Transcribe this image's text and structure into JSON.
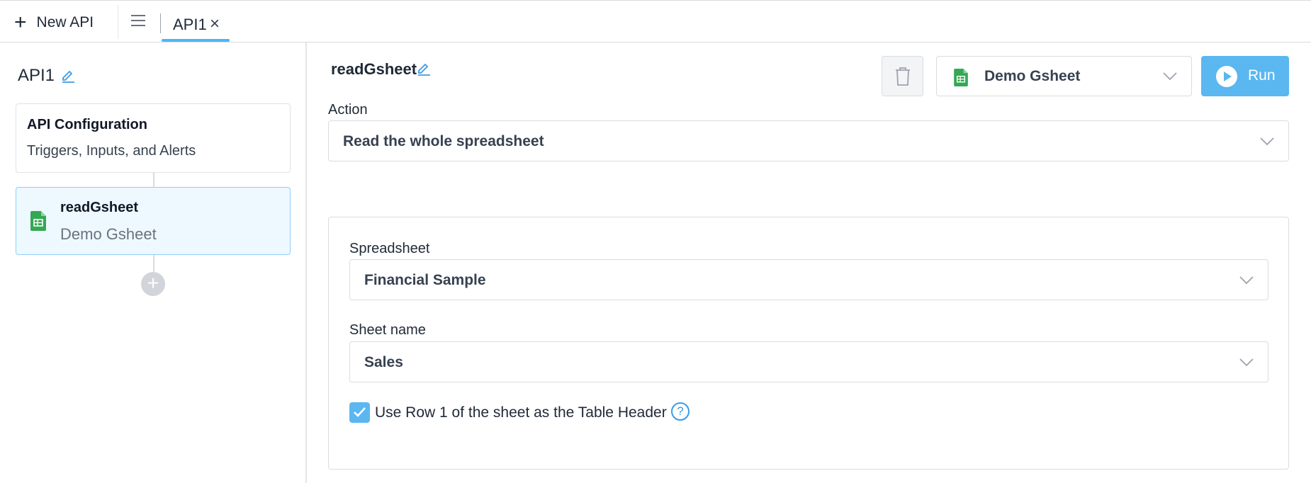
{
  "topbar": {
    "new_api_label": "New API",
    "tab": {
      "label": "API1"
    }
  },
  "sidebar": {
    "api_name": "API1",
    "config_card": {
      "title": "API Configuration",
      "subtitle": "Triggers, Inputs, and Alerts"
    },
    "step_card": {
      "title": "readGsheet",
      "subtitle": "Demo Gsheet"
    }
  },
  "main": {
    "step_name": "readGsheet",
    "datasource": "Demo Gsheet",
    "run_label": "Run",
    "action": {
      "label": "Action",
      "value": "Read the whole spreadsheet"
    },
    "spreadsheet": {
      "label": "Spreadsheet",
      "value": "Financial Sample"
    },
    "sheet_name": {
      "label": "Sheet name",
      "value": "Sales"
    },
    "header_checkbox": {
      "label": "Use Row 1 of the sheet as the Table Header",
      "checked": true
    }
  },
  "colors": {
    "accent": "#5ab7f0",
    "selected_card_bg": "#eef8ff",
    "sheets_green": "#34a853"
  },
  "icons": [
    "plus-icon",
    "menu-icon",
    "close-icon",
    "edit-icon",
    "google-sheets-icon",
    "trash-icon",
    "chevron-down-icon",
    "play-icon",
    "check-icon",
    "help-icon"
  ]
}
